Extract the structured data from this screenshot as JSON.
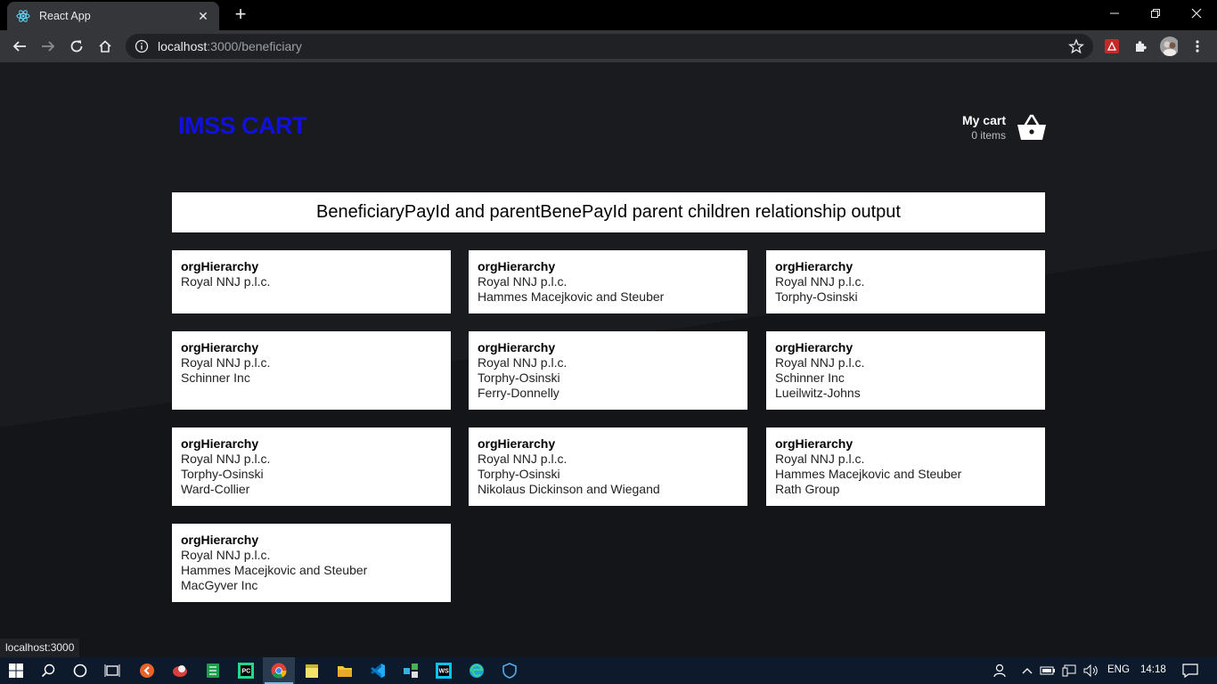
{
  "browser": {
    "tab_title": "React App",
    "url_host": "localhost",
    "url_rest": ":3000/beneficiary",
    "status_tooltip": "localhost:3000"
  },
  "header": {
    "brand": "IMSS CART",
    "cart_label": "My cart",
    "cart_count": "0 items"
  },
  "main": {
    "heading": "BeneficiaryPayId and parentBenePayId parent children relationship output",
    "cards": [
      {
        "title": "orgHierarchy",
        "lines": [
          "Royal NNJ p.l.c."
        ]
      },
      {
        "title": "orgHierarchy",
        "lines": [
          "Royal NNJ p.l.c.",
          "Hammes Macejkovic and Steuber"
        ]
      },
      {
        "title": "orgHierarchy",
        "lines": [
          "Royal NNJ p.l.c.",
          "Torphy-Osinski"
        ]
      },
      {
        "title": "orgHierarchy",
        "lines": [
          "Royal NNJ p.l.c.",
          "Schinner Inc"
        ]
      },
      {
        "title": "orgHierarchy",
        "lines": [
          "Royal NNJ p.l.c.",
          "Torphy-Osinski",
          "Ferry-Donnelly"
        ]
      },
      {
        "title": "orgHierarchy",
        "lines": [
          "Royal NNJ p.l.c.",
          "Schinner Inc",
          "Lueilwitz-Johns"
        ]
      },
      {
        "title": "orgHierarchy",
        "lines": [
          "Royal NNJ p.l.c.",
          "Torphy-Osinski",
          "Ward-Collier"
        ]
      },
      {
        "title": "orgHierarchy",
        "lines": [
          "Royal NNJ p.l.c.",
          "Torphy-Osinski",
          "Nikolaus Dickinson and Wiegand"
        ]
      },
      {
        "title": "orgHierarchy",
        "lines": [
          "Royal NNJ p.l.c.",
          "Hammes Macejkovic and Steuber",
          "Rath Group"
        ]
      },
      {
        "title": "orgHierarchy",
        "lines": [
          "Royal NNJ p.l.c.",
          "Hammes Macejkovic and Steuber",
          "MacGyver Inc"
        ]
      }
    ]
  },
  "taskbar": {
    "language": "ENG",
    "time": "14:18"
  },
  "colors": {
    "brand": "#1010e0",
    "page_bg": "#1a1b1f"
  }
}
